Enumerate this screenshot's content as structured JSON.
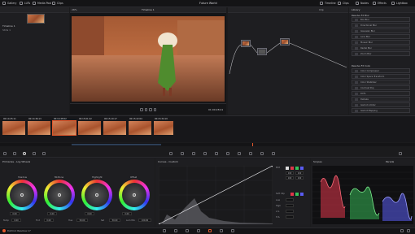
{
  "app": {
    "title": "Future World",
    "footer_app": "DaVinci Resolve 17"
  },
  "topbar": {
    "left_buttons": [
      "Gallery",
      "LUTs",
      "Media Pool",
      "Clips"
    ],
    "center_label": "Timeline 1",
    "right_buttons": [
      "Timeline",
      "Clips",
      "Nodes",
      "Effects",
      "Lightbox"
    ],
    "clip_label": "Clip",
    "zoom": "28%",
    "viewer_label": "Clip"
  },
  "left_panel": {
    "thumb_label": "Future World",
    "items": [
      "Timeline 1",
      "Stills 1"
    ]
  },
  "viewer": {
    "timecode": "01:00:28:21"
  },
  "library": {
    "header": "Library",
    "section1": "Resolve FX Blur",
    "items1": [
      "Box Blur",
      "Directional Blur",
      "Gaussian Blur",
      "Lens Blur",
      "Mosaic Blur",
      "Radial Blur",
      "Zoom Blur"
    ],
    "section2": "Resolve FX Color",
    "items2": [
      "Color Compressor",
      "Color Space Transform",
      "Color Stabilizer",
      "Contrast Pop",
      "DCTL",
      "Dehaze",
      "Gamut Limiter",
      "Gamut Mapping"
    ]
  },
  "clips": [
    {
      "num": "01",
      "tc": "00:14:25:11",
      "codec": "H.264"
    },
    {
      "num": "02",
      "tc": "00:14:36:13",
      "codec": "H.264"
    },
    {
      "num": "03",
      "tc": "00:14:48:02",
      "codec": "H.264"
    },
    {
      "num": "04",
      "tc": "00:15:01:22",
      "codec": "H.264"
    },
    {
      "num": "05",
      "tc": "00:15:10:17",
      "codec": "H.264"
    },
    {
      "num": "06",
      "tc": "00:15:22:04",
      "codec": "H.264"
    },
    {
      "num": "07",
      "tc": "00:15:34:19",
      "codec": "H.264"
    }
  ],
  "color_panel": {
    "header": "Primaries - Log Wheels",
    "wheels": [
      "Shadow",
      "Midtone",
      "Highlight",
      "Offset"
    ],
    "values": [
      "0.00",
      "0.00",
      "0.00",
      "0.00"
    ],
    "params": [
      "Temp",
      "Tint",
      "Hue",
      "Sat",
      "Lum Mix"
    ],
    "param_values": [
      "0.00",
      "0.00",
      "50.00",
      "50.00",
      "100.00"
    ]
  },
  "curves": {
    "header": "Curves - Custom",
    "options": [
      "Edit",
      "Soft Clip",
      "Low",
      "High",
      "L.S.",
      "H.S."
    ],
    "values": [
      "100",
      "100",
      "100",
      "100"
    ]
  },
  "scopes": {
    "header": "Scopes",
    "mode": "Parade",
    "scale": [
      "1023",
      "896",
      "768",
      "640",
      "512",
      "384",
      "256",
      "128",
      "0"
    ]
  },
  "colors": {
    "accent": "#e2572b",
    "panel": "#1e1e21",
    "red": "#e0364a",
    "green": "#37c35a",
    "blue": "#5a5cf2"
  }
}
